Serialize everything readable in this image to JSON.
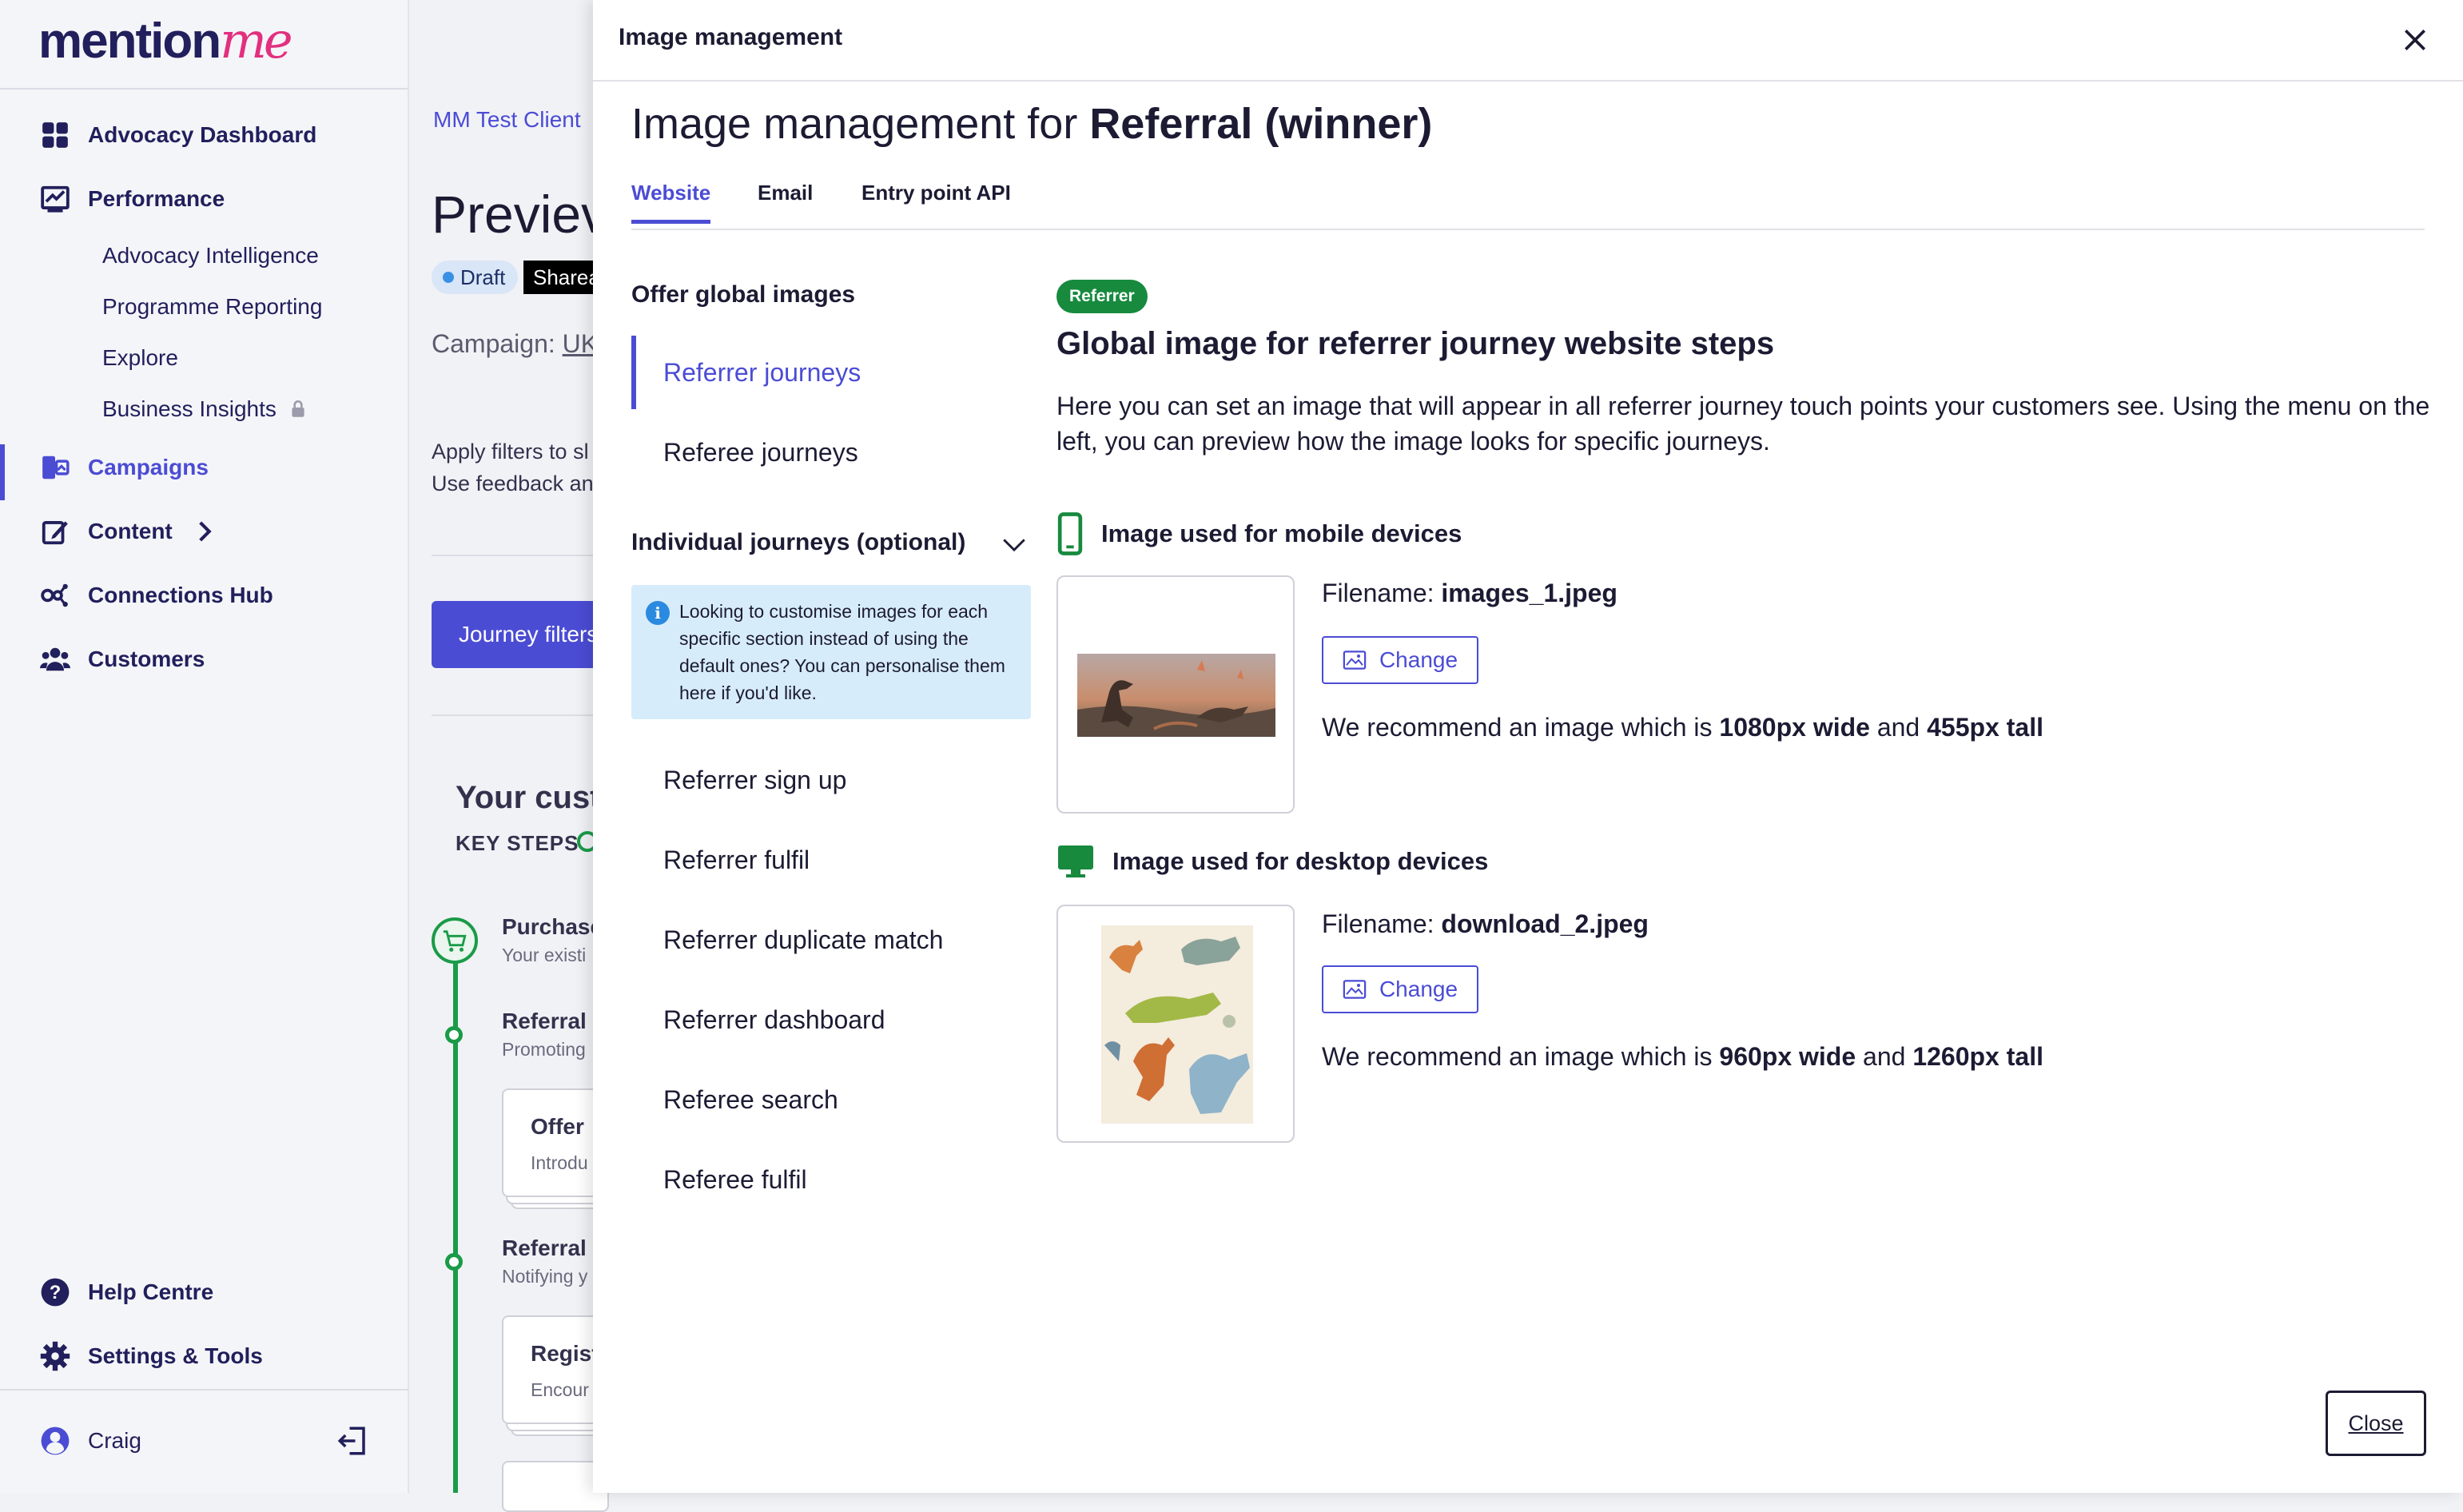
{
  "brand": {
    "logo_part1": "mention",
    "logo_part2": "me",
    "accent": "#4b4cd4",
    "logo_pink": "#e2307f"
  },
  "sidebar": {
    "items": [
      {
        "label": "Advocacy Dashboard",
        "icon": "grid-icon"
      },
      {
        "label": "Performance",
        "icon": "chart-icon"
      },
      {
        "label": "Campaigns",
        "icon": "campaigns-icon",
        "active": true
      },
      {
        "label": "Content",
        "icon": "edit-icon"
      },
      {
        "label": "Connections Hub",
        "icon": "connections-icon"
      },
      {
        "label": "Customers",
        "icon": "customers-icon"
      }
    ],
    "performance_sub": [
      "Advocacy Intelligence",
      "Programme Reporting",
      "Explore",
      "Business Insights"
    ],
    "footer": {
      "help": "Help Centre",
      "settings": "Settings & Tools",
      "user": "Craig"
    }
  },
  "background": {
    "breadcrumb": "MM Test Client",
    "title": "Previev",
    "badge_draft": "Draft",
    "badge_share": "Sharea",
    "campaign_label": "Campaign: ",
    "campaign_value": "UK",
    "filters_line1": "Apply filters to sl",
    "filters_line2": "Use feedback an",
    "journey_button": "Journey filters",
    "your_customers": "Your custo",
    "key_steps": "KEY STEPS",
    "timeline": [
      {
        "title": "Purchase",
        "sub": "Your existi"
      },
      {
        "title": "Referral c",
        "sub": "Promoting"
      },
      {
        "title": "Offer",
        "sub": "Introdu"
      },
      {
        "title": "Referral e",
        "sub": "Notifying y"
      },
      {
        "title": "Regist",
        "sub": "Encour"
      }
    ]
  },
  "panel": {
    "header_title": "Image management",
    "heading_prefix": "Image management for ",
    "heading_bold": "Referral (winner)",
    "tabs": [
      {
        "label": "Website",
        "active": true
      },
      {
        "label": "Email"
      },
      {
        "label": "Entry point API"
      }
    ],
    "offer_global_heading": "Offer global images",
    "global_items": [
      {
        "label": "Referrer journeys",
        "active": true
      },
      {
        "label": "Referee journeys"
      }
    ],
    "individual_heading": "Individual journeys (optional)",
    "info_text": "Looking to customise images for each specific section instead of using the default ones? You can personalise them here if you'd like.",
    "individual_items": [
      "Referrer sign up",
      "Referrer fulfil",
      "Referrer duplicate match",
      "Referrer dashboard",
      "Referee search",
      "Referee fulfil"
    ],
    "badge": "Referrer",
    "content_title": "Global image for referrer journey website steps",
    "content_desc": "Here you can set an image that will appear in all referrer journey touch points your customers see. Using the menu on the left, you can preview how the image looks for specific journeys.",
    "mobile": {
      "heading": "Image used for mobile devices",
      "filename_label": "Filename: ",
      "filename": "images_1.jpeg",
      "change": "Change",
      "rec_prefix": "We recommend an image which is ",
      "rec_width": "1080px wide",
      "rec_and": " and ",
      "rec_height": "455px tall"
    },
    "desktop": {
      "heading": "Image used for desktop devices",
      "filename_label": "Filename: ",
      "filename": "download_2.jpeg",
      "change": "Change",
      "rec_prefix": "We recommend an image which is ",
      "rec_width": "960px wide",
      "rec_and": " and ",
      "rec_height": "1260px tall"
    },
    "close_button": "Close"
  }
}
